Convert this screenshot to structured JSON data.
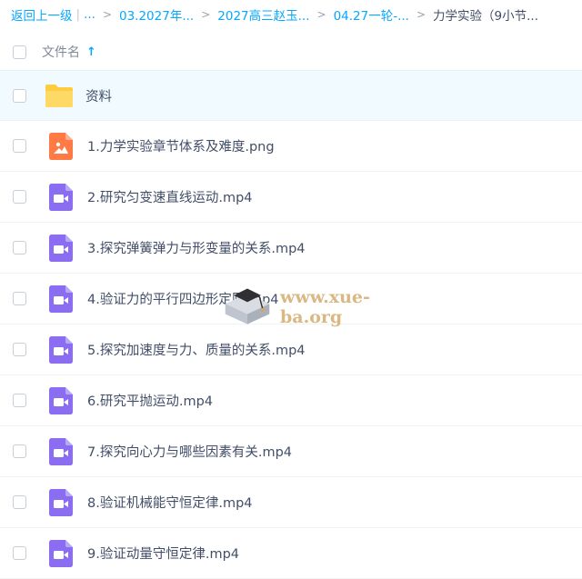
{
  "breadcrumb": {
    "back": "返回上一级",
    "separator_bar": "|",
    "items": [
      "...",
      "03.2027年...",
      "2027高三赵玉...",
      "04.27一轮-...",
      "力学实验（9小节..."
    ]
  },
  "header": {
    "name_label": "文件名",
    "sort_arrow": "↑"
  },
  "files": [
    {
      "name": "资料",
      "type": "folder"
    },
    {
      "name": "1.力学实验章节体系及难度.png",
      "type": "image"
    },
    {
      "name": "2.研究匀变速直线运动.mp4",
      "type": "video"
    },
    {
      "name": "3.探究弹簧弹力与形变量的关系.mp4",
      "type": "video"
    },
    {
      "name": "4.验证力的平行四边形定则.mp4",
      "type": "video"
    },
    {
      "name": "5.探究加速度与力、质量的关系.mp4",
      "type": "video"
    },
    {
      "name": "6.研究平抛运动.mp4",
      "type": "video"
    },
    {
      "name": "7.探究向心力与哪些因素有关.mp4",
      "type": "video"
    },
    {
      "name": "8.验证机械能守恒定律.mp4",
      "type": "video"
    },
    {
      "name": "9.验证动量守恒定律.mp4",
      "type": "video"
    }
  ],
  "watermark": {
    "text": "www.xue-ba.org"
  },
  "colors": {
    "accent": "#06a7ff",
    "folder": "#ffd75a",
    "image_icon": "#ff7a45",
    "video_icon": "#8a6df1"
  }
}
